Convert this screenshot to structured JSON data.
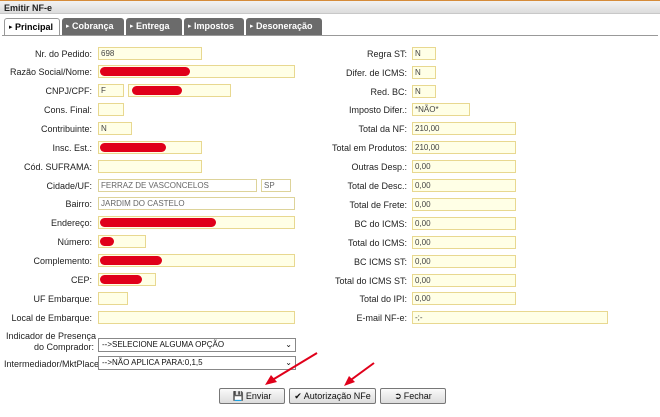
{
  "window": {
    "title": "Emitir NF-e"
  },
  "tabs": [
    {
      "label": "Principal"
    },
    {
      "label": "Cobrança"
    },
    {
      "label": "Entrega"
    },
    {
      "label": "Impostos"
    },
    {
      "label": "Desoneração"
    }
  ],
  "left": {
    "nr_pedido": {
      "label": "Nr. do Pedido:",
      "value": "698"
    },
    "razao_social": {
      "label": "Razão Social/Nome:",
      "value": ""
    },
    "cnpj_cpf": {
      "label": "CNPJ/CPF:",
      "type": "F",
      "value": ""
    },
    "cons_final": {
      "label": "Cons. Final:",
      "value": ""
    },
    "contribuinte": {
      "label": "Contribuinte:",
      "value": "N"
    },
    "insc_est": {
      "label": "Insc. Est.:",
      "value": ""
    },
    "cod_suframa": {
      "label": "Cód. SUFRAMA:",
      "value": ""
    },
    "cidade_uf": {
      "label": "Cidade/UF:",
      "cidade": "FERRAZ DE VASCONCELOS",
      "uf": "SP"
    },
    "bairro": {
      "label": "Bairro:",
      "value": "JARDIM DO CASTELO"
    },
    "endereco": {
      "label": "Endereço:",
      "value": ""
    },
    "numero": {
      "label": "Número:",
      "value": ""
    },
    "complemento": {
      "label": "Complemento:",
      "value": ""
    },
    "cep": {
      "label": "CEP:",
      "value": ""
    },
    "uf_embarque": {
      "label": "UF Embarque:",
      "value": ""
    },
    "local_embarque": {
      "label": "Local de Embarque:",
      "value": ""
    },
    "indicador_presenca": {
      "label_line1": "Indicador de Presença",
      "label_line2": "do Comprador:",
      "selected": "-->SELECIONE ALGUMA OPÇÃO"
    },
    "intermediador": {
      "label": "Intermediador/MktPlace:",
      "selected": "-->NÃO APLICA PARA:0,1,5"
    }
  },
  "right": {
    "regra_st": {
      "label": "Regra ST:",
      "value": "N"
    },
    "difer_icms": {
      "label": "Difer. de ICMS:",
      "value": "N"
    },
    "red_bc": {
      "label": "Red. BC:",
      "value": "N"
    },
    "imposto_difer": {
      "label": "Imposto Difer.:",
      "value": "*NÃO*"
    },
    "total_nf": {
      "label": "Total da NF:",
      "value": "210,00"
    },
    "total_produtos": {
      "label": "Total em Produtos:",
      "value": "210,00"
    },
    "outras_desp": {
      "label": "Outras Desp.:",
      "value": "0,00"
    },
    "total_desc": {
      "label": "Total de Desc.:",
      "value": "0,00"
    },
    "total_frete": {
      "label": "Total de Frete:",
      "value": "0,00"
    },
    "bc_icms": {
      "label": "BC do ICMS:",
      "value": "0,00"
    },
    "total_icms": {
      "label": "Total do ICMS:",
      "value": "0,00"
    },
    "bc_icms_st": {
      "label": "BC ICMS ST:",
      "value": "0,00"
    },
    "total_icms_st": {
      "label": "Total do ICMS ST:",
      "value": "0,00"
    },
    "total_ipi": {
      "label": "Total do IPI:",
      "value": "0,00"
    },
    "email_nfe": {
      "label": "E-mail NF-e:",
      "value": "-;-"
    }
  },
  "buttons": {
    "enviar": "Enviar",
    "autorizacao": "Autorização NFe",
    "fechar": "Fechar"
  },
  "colors": {
    "tab_bg": "#6b6b6b",
    "field_bg": "#ffffe6",
    "field_border": "#e8d890",
    "redaction": "#e0001a",
    "arrow": "#e0001a"
  },
  "icons": {
    "tab_arrow": "triangle-right-icon",
    "enviar": "save-icon",
    "autorizacao": "check-circle-icon",
    "fechar": "exit-icon"
  }
}
